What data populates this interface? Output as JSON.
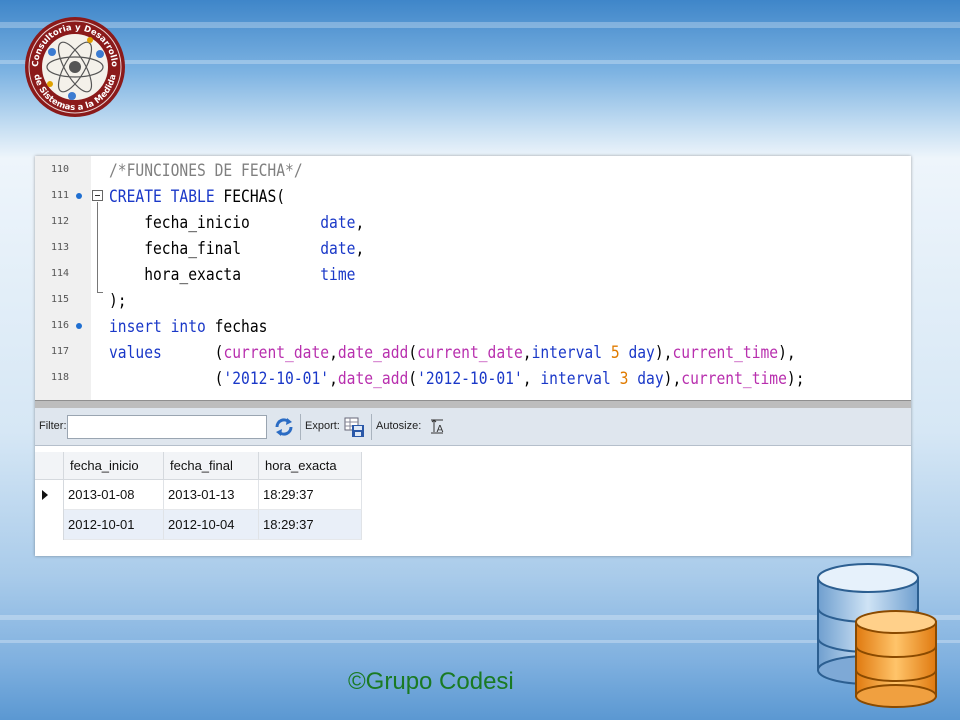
{
  "logo": {
    "text_top": "Consultoria y Desarrollo",
    "text_bottom": "de Sistemas a la Medida"
  },
  "editor": {
    "lines": [
      {
        "number": "110",
        "marker": false,
        "code": [
          {
            "t": "cm",
            "v": "/*FUNCIONES DE FECHA*/"
          }
        ]
      },
      {
        "number": "111",
        "marker": true,
        "code": [
          {
            "t": "kw",
            "v": "CREATE TABLE"
          },
          {
            "t": "",
            "v": " FECHAS("
          }
        ]
      },
      {
        "number": "112",
        "marker": false,
        "code": [
          {
            "t": "",
            "v": "    fecha_inicio        "
          },
          {
            "t": "kw",
            "v": "date"
          },
          {
            "t": "",
            "v": ","
          }
        ]
      },
      {
        "number": "113",
        "marker": false,
        "code": [
          {
            "t": "",
            "v": "    fecha_final         "
          },
          {
            "t": "kw",
            "v": "date"
          },
          {
            "t": "",
            "v": ","
          }
        ]
      },
      {
        "number": "114",
        "marker": false,
        "code": [
          {
            "t": "",
            "v": "    hora_exacta         "
          },
          {
            "t": "kw",
            "v": "time"
          }
        ]
      },
      {
        "number": "115",
        "marker": false,
        "code": [
          {
            "t": "",
            "v": ");"
          }
        ]
      },
      {
        "number": "116",
        "marker": true,
        "code": [
          {
            "t": "kw",
            "v": "insert into"
          },
          {
            "t": "",
            "v": " fechas"
          }
        ]
      },
      {
        "number": "117",
        "marker": false,
        "code": [
          {
            "t": "kw",
            "v": "values"
          },
          {
            "t": "",
            "v": "      ("
          },
          {
            "t": "fn",
            "v": "current_date"
          },
          {
            "t": "",
            "v": ","
          },
          {
            "t": "fn",
            "v": "date_add"
          },
          {
            "t": "",
            "v": "("
          },
          {
            "t": "fn",
            "v": "current_date"
          },
          {
            "t": "",
            "v": ","
          },
          {
            "t": "kw",
            "v": "interval"
          },
          {
            "t": "",
            "v": " "
          },
          {
            "t": "num",
            "v": "5"
          },
          {
            "t": "",
            "v": " "
          },
          {
            "t": "kw",
            "v": "day"
          },
          {
            "t": "",
            "v": "),"
          },
          {
            "t": "fn",
            "v": "current_time"
          },
          {
            "t": "",
            "v": "),"
          }
        ]
      },
      {
        "number": "118",
        "marker": false,
        "code": [
          {
            "t": "",
            "v": "            ("
          },
          {
            "t": "str",
            "v": "'2012-10-01'"
          },
          {
            "t": "",
            "v": ","
          },
          {
            "t": "fn",
            "v": "date_add"
          },
          {
            "t": "",
            "v": "("
          },
          {
            "t": "str",
            "v": "'2012-10-01'"
          },
          {
            "t": "",
            "v": ", "
          },
          {
            "t": "kw",
            "v": "interval"
          },
          {
            "t": "",
            "v": " "
          },
          {
            "t": "num",
            "v": "3"
          },
          {
            "t": "",
            "v": " "
          },
          {
            "t": "kw",
            "v": "day"
          },
          {
            "t": "",
            "v": "),"
          },
          {
            "t": "fn",
            "v": "current_time"
          },
          {
            "t": "",
            "v": ");"
          }
        ]
      }
    ]
  },
  "toolbar": {
    "filter_label": "Filter:",
    "filter_value": "",
    "export_label": "Export:",
    "autosize_label": "Autosize:"
  },
  "grid": {
    "columns": [
      "fecha_inicio",
      "fecha_final",
      "hora_exacta"
    ],
    "rows": [
      [
        "2013-01-08",
        "2013-01-13",
        "18:29:37"
      ],
      [
        "2012-10-01",
        "2012-10-04",
        "18:29:37"
      ]
    ]
  },
  "footer": {
    "copyright": "©Grupo Codesi"
  },
  "colors": {
    "keyword": "#1a38c8",
    "function": "#b82fae",
    "number": "#e07b00",
    "comment": "#808080",
    "footer": "#1a7a23"
  }
}
